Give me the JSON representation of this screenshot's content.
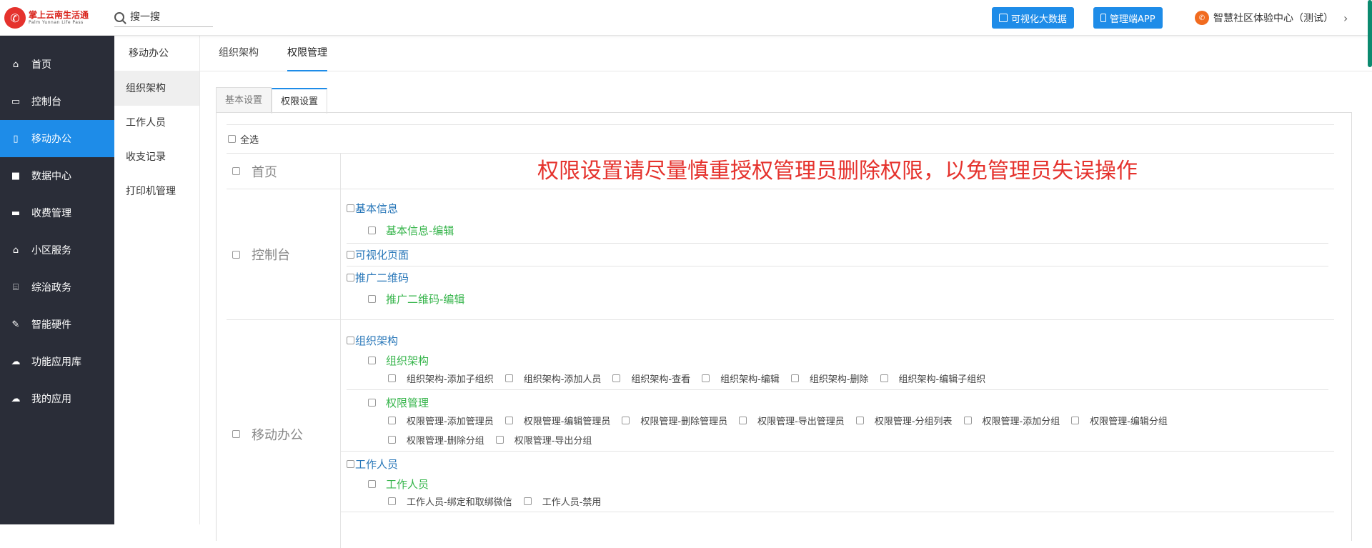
{
  "header": {
    "logo_cn": "掌上云南生活通",
    "logo_en": "Palm Yunnan Life Pass",
    "search_placeholder": "搜一搜",
    "btn_bigdata": "可视化大数据",
    "btn_app": "管理端APP",
    "user_name": "智慧社区体验中心（测试）"
  },
  "colors": {
    "accent": "#1e8ce8",
    "sidebar": "#2a2d38",
    "warning": "#e5322d",
    "level1": "#2776b8",
    "level2": "#35b44a"
  },
  "sidebar": {
    "items": [
      {
        "label": "首页",
        "icon": "home-icon"
      },
      {
        "label": "控制台",
        "icon": "laptop-icon"
      },
      {
        "label": "移动办公",
        "icon": "mobile-icon"
      },
      {
        "label": "数据中心",
        "icon": "briefcase-icon"
      },
      {
        "label": "收费管理",
        "icon": "credit-card-icon"
      },
      {
        "label": "小区服务",
        "icon": "home-icon"
      },
      {
        "label": "综治政务",
        "icon": "bank-icon"
      },
      {
        "label": "智能硬件",
        "icon": "wrench-icon"
      },
      {
        "label": "功能应用库",
        "icon": "cloud-download-icon"
      },
      {
        "label": "我的应用",
        "icon": "cloud-icon"
      }
    ]
  },
  "subnav": {
    "title": "移动办公",
    "items": [
      "组织架构",
      "工作人员",
      "收支记录",
      "打印机管理"
    ]
  },
  "tabs": [
    "组织架构",
    "权限管理"
  ],
  "panel_tabs": [
    "基本设置",
    "权限设置"
  ],
  "select_all": "全选",
  "warning": "权限设置请尽量慎重授权管理员删除权限，以免管理员失误操作",
  "sections": {
    "home": "首页",
    "console": {
      "label": "控制台",
      "basic": "基本信息",
      "basic_edit": "基本信息-编辑",
      "visual": "可视化页面",
      "qrcode": "推广二维码",
      "qrcode_edit": "推广二维码-编辑"
    },
    "mobile": {
      "label": "移动办公",
      "org": "组织架构",
      "org_sub": "组织架构",
      "org_perms": [
        "组织架构-添加子组织",
        "组织架构-添加人员",
        "组织架构-查看",
        "组织架构-编辑",
        "组织架构-删除",
        "组织架构-编辑子组织"
      ],
      "perm": "权限管理",
      "perm_perms": [
        "权限管理-添加管理员",
        "权限管理-编辑管理员",
        "权限管理-删除管理员",
        "权限管理-导出管理员",
        "权限管理-分组列表",
        "权限管理-添加分组",
        "权限管理-编辑分组",
        "权限管理-删除分组",
        "权限管理-导出分组"
      ],
      "staff": "工作人员",
      "staff_sub": "工作人员",
      "staff_perms": [
        "工作人员-绑定和取绑微信",
        "工作人员-禁用"
      ]
    }
  }
}
